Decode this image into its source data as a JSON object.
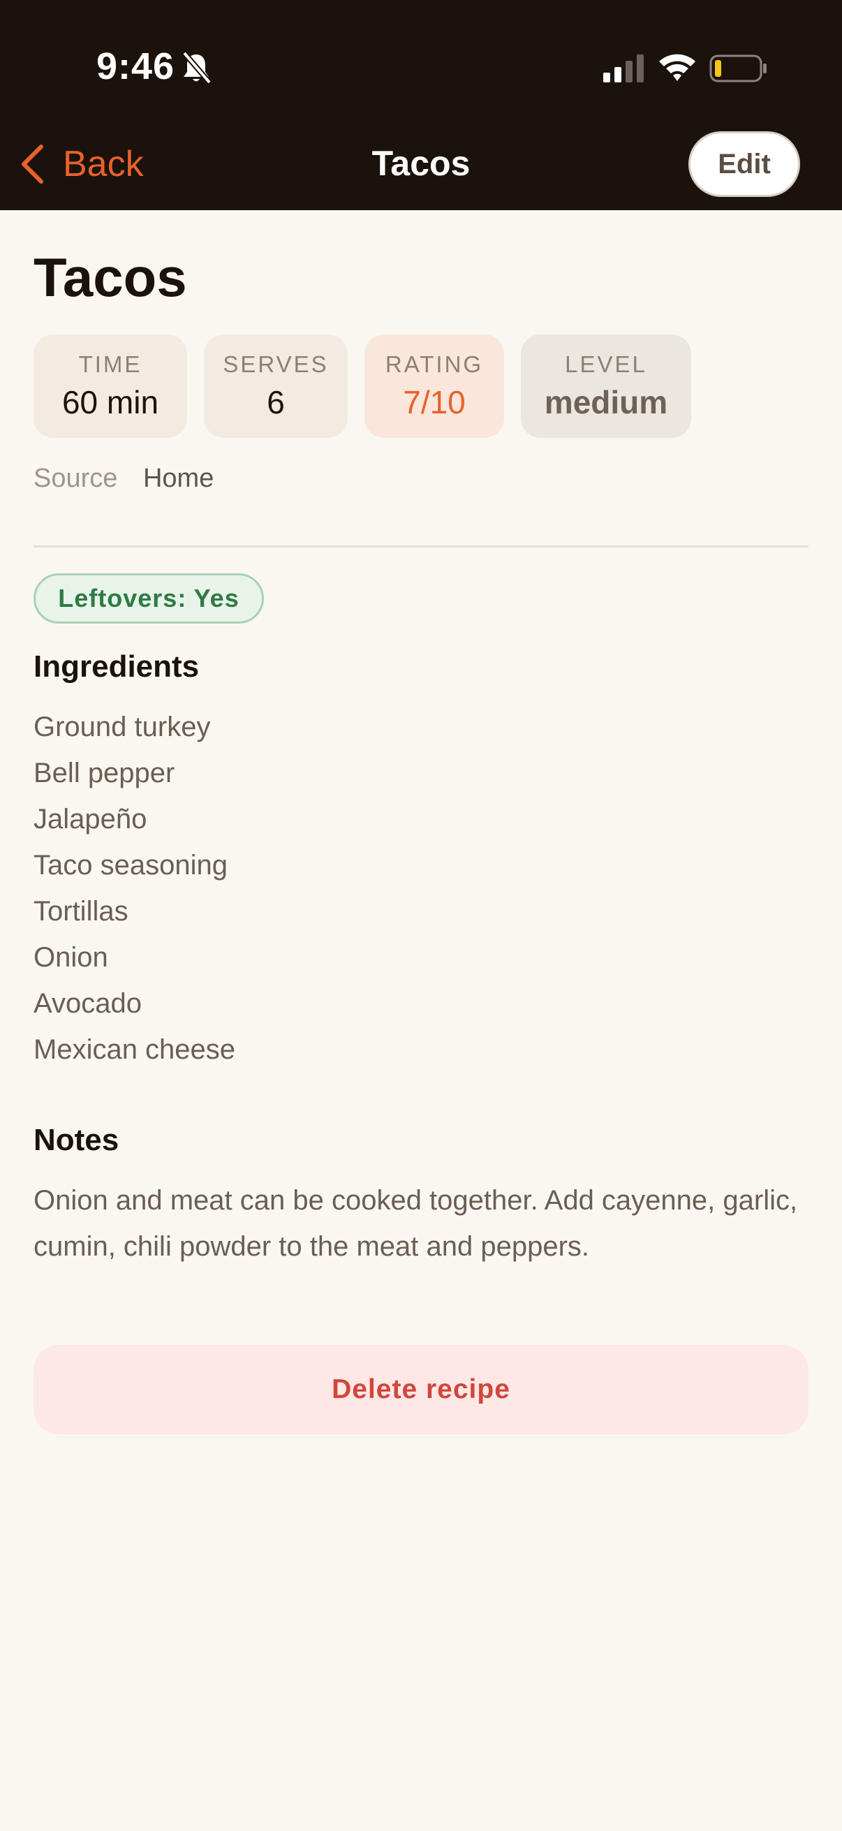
{
  "status_bar": {
    "time": "9:46"
  },
  "nav": {
    "back_label": "Back",
    "title": "Tacos",
    "edit_label": "Edit"
  },
  "recipe": {
    "title": "Tacos",
    "stats": {
      "time": {
        "label": "TIME",
        "value": "60 min"
      },
      "serves": {
        "label": "SERVES",
        "value": "6"
      },
      "rating": {
        "label": "RATING",
        "value": "7/10"
      },
      "level": {
        "label": "LEVEL",
        "value": "medium"
      }
    },
    "source": {
      "label": "Source",
      "value": "Home"
    },
    "leftovers_badge": "Leftovers: Yes",
    "ingredients_title": "Ingredients",
    "ingredients": [
      "Ground turkey",
      "Bell pepper",
      "Jalapeño",
      "Taco seasoning",
      "Tortillas",
      "Onion",
      "Avocado",
      "Mexican cheese"
    ],
    "notes_title": "Notes",
    "notes": "Onion and meat can be cooked together. Add cayenne, garlic, cumin, chili powder to the meat and peppers.",
    "delete_label": "Delete recipe"
  },
  "colors": {
    "accent": "#e8612c",
    "header_bg": "#1b120c",
    "page_bg": "#faf7f2",
    "leftovers_green": "#2e7a45",
    "delete_red": "#d0473b"
  }
}
